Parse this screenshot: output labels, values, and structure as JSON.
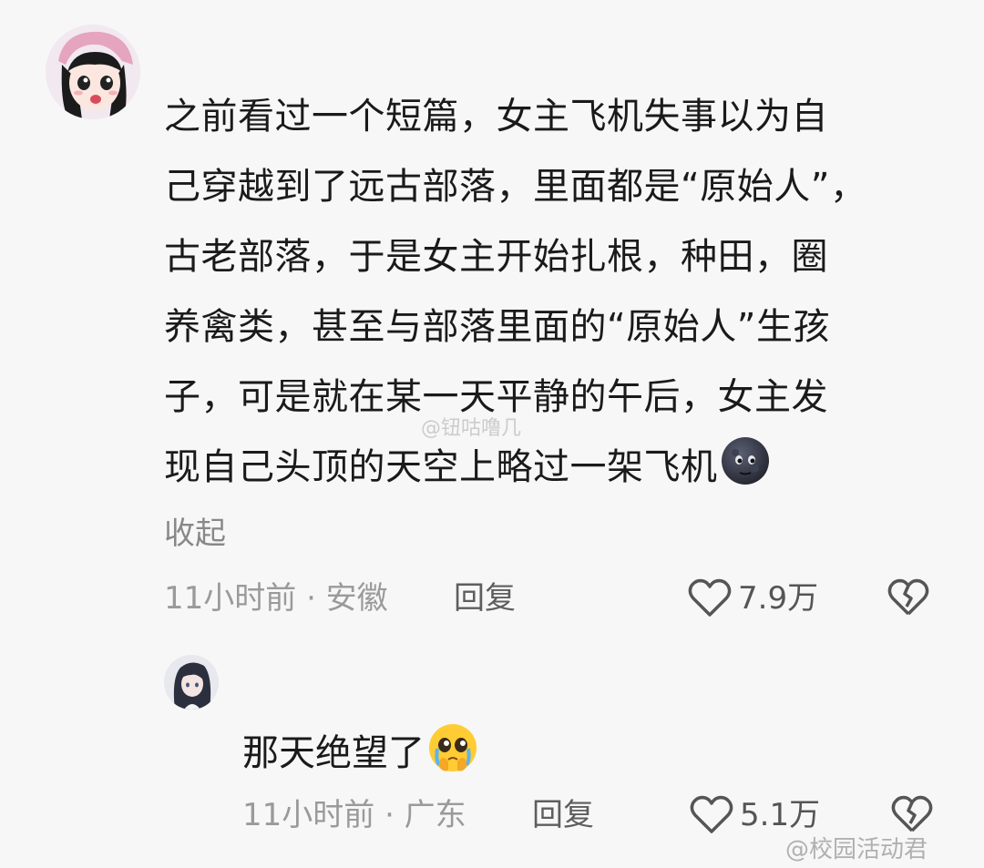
{
  "comment": {
    "lines": [
      "之前看过一个短篇，女主飞机失事以为自",
      "己穿越到了远古部落，里面都是“原始人”，",
      "古老部落，于是女主开始扎根，种田，圈",
      "养禽类，甚至与部落里面的“原始人”生孩",
      "子，可是就在某一天平静的午后，女主发",
      "现自己头顶的天空上略过一架飞机"
    ],
    "emoji": "new-moon-face-emoji",
    "collapse_label": "收起",
    "time_location": "11小时前 · 安徽",
    "reply_label": "回复",
    "likes": "7.9万"
  },
  "reply": {
    "text": "那天绝望了",
    "emoji": "pleading-face-emoji",
    "time_location": "11小时前 · 广东",
    "reply_label": "回复",
    "likes": "5.1万"
  },
  "watermarks": {
    "center": "@钮咕噜几",
    "corner": "@校园活动君"
  },
  "icons": {
    "like": "heart-outline-icon",
    "dislike": "broken-heart-icon"
  }
}
